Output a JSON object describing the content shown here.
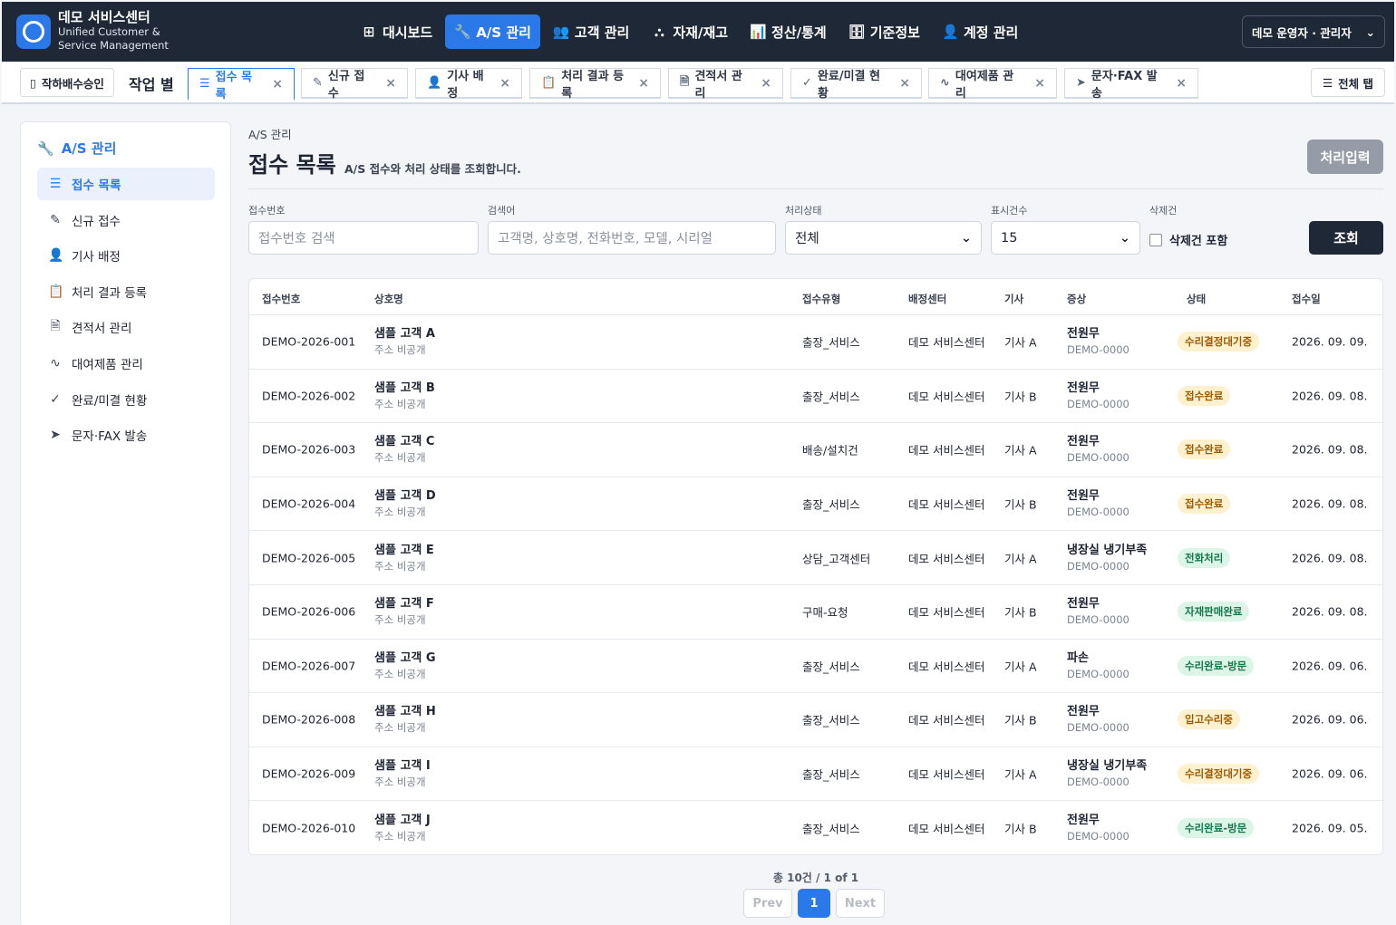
{
  "brand": {
    "title": "데모 서비스센터",
    "subtitle": "Unified Customer & Service Management"
  },
  "nav": [
    {
      "label": "대시보드",
      "icon": "grid-icon",
      "glyph": "⊞"
    },
    {
      "label": "A/S 관리",
      "icon": "wrench-icon",
      "glyph": "🔧"
    },
    {
      "label": "고객 관리",
      "icon": "users-icon",
      "glyph": "👥"
    },
    {
      "label": "자재/재고",
      "icon": "boxes-icon",
      "glyph": "⛬"
    },
    {
      "label": "정산/통계",
      "icon": "bar-chart-icon",
      "glyph": "📊"
    },
    {
      "label": "기준정보",
      "icon": "database-icon",
      "glyph": "🗄"
    },
    {
      "label": "계정 관리",
      "icon": "user-settings-icon",
      "glyph": "👤"
    }
  ],
  "user": {
    "label": "데모 운영자 · 관리자"
  },
  "tabbar": {
    "approve_button": "작하배수승인",
    "work_label": "작업 별",
    "all_tabs": "전체 탭",
    "tabs": [
      {
        "label": "접수 목록",
        "glyph": "☰"
      },
      {
        "label": "신규 접수",
        "glyph": "✎"
      },
      {
        "label": "기사 배정",
        "glyph": "👤"
      },
      {
        "label": "처리 결과 등록",
        "glyph": "📋"
      },
      {
        "label": "견적서 관리",
        "glyph": "🗎"
      },
      {
        "label": "완료/미결 현황",
        "glyph": "✓"
      },
      {
        "label": "대여제품 관리",
        "glyph": "∿"
      },
      {
        "label": "문자·FAX 발송",
        "glyph": "➤"
      }
    ]
  },
  "sidebar": {
    "heading": "A/S 관리",
    "items": [
      {
        "label": "접수 목록",
        "glyph": "☰"
      },
      {
        "label": "신규 접수",
        "glyph": "✎"
      },
      {
        "label": "기사 배정",
        "glyph": "👤"
      },
      {
        "label": "처리 결과 등록",
        "glyph": "📋"
      },
      {
        "label": "견적서 관리",
        "glyph": "🗎"
      },
      {
        "label": "대여제품 관리",
        "glyph": "∿"
      },
      {
        "label": "완료/미결 현황",
        "glyph": "✓"
      },
      {
        "label": "문자·FAX 발송",
        "glyph": "➤"
      }
    ]
  },
  "page": {
    "breadcrumb": "A/S 관리",
    "title": "접수 목록",
    "description": "A/S 접수와 처리 상태를 조회합니다.",
    "process_button": "처리입력"
  },
  "filters": {
    "receipt_label": "접수번호",
    "receipt_placeholder": "접수번호 검색",
    "search_label": "검색어",
    "search_placeholder": "고객명, 상호명, 전화번호, 모델, 시리얼",
    "status_label": "처리상태",
    "status_value": "전체",
    "count_label": "표시건수",
    "count_value": "15",
    "deleted_label": "삭제건",
    "deleted_checkbox": "삭제건 포함",
    "search_button": "조회"
  },
  "table": {
    "headers": [
      "접수번호",
      "상호명",
      "접수유형",
      "배정센터",
      "기사",
      "증상",
      "상태",
      "접수일"
    ],
    "rows": [
      {
        "id": "DEMO-2026-001",
        "name": "샘플 고객 A",
        "addr": "주소 비공개",
        "type": "출장_서비스",
        "center": "데모 서비스센터",
        "tech": "기사 A",
        "symptom": "전원무",
        "code": "DEMO-0000",
        "status": "수리결정대기중",
        "status_kind": "amber",
        "date": "2026. 09. 09."
      },
      {
        "id": "DEMO-2026-002",
        "name": "샘플 고객 B",
        "addr": "주소 비공개",
        "type": "출장_서비스",
        "center": "데모 서비스센터",
        "tech": "기사 B",
        "symptom": "전원무",
        "code": "DEMO-0000",
        "status": "접수완료",
        "status_kind": "amber",
        "date": "2026. 09. 08."
      },
      {
        "id": "DEMO-2026-003",
        "name": "샘플 고객 C",
        "addr": "주소 비공개",
        "type": "배송/설치건",
        "center": "데모 서비스센터",
        "tech": "기사 A",
        "symptom": "전원무",
        "code": "DEMO-0000",
        "status": "접수완료",
        "status_kind": "amber",
        "date": "2026. 09. 08."
      },
      {
        "id": "DEMO-2026-004",
        "name": "샘플 고객 D",
        "addr": "주소 비공개",
        "type": "출장_서비스",
        "center": "데모 서비스센터",
        "tech": "기사 B",
        "symptom": "전원무",
        "code": "DEMO-0000",
        "status": "접수완료",
        "status_kind": "amber",
        "date": "2026. 09. 08."
      },
      {
        "id": "DEMO-2026-005",
        "name": "샘플 고객 E",
        "addr": "주소 비공개",
        "type": "상담_고객센터",
        "center": "데모 서비스센터",
        "tech": "기사 A",
        "symptom": "냉장실 냉기부족",
        "code": "DEMO-0000",
        "status": "전화처리",
        "status_kind": "green",
        "date": "2026. 09. 08."
      },
      {
        "id": "DEMO-2026-006",
        "name": "샘플 고객 F",
        "addr": "주소 비공개",
        "type": "구매-요청",
        "center": "데모 서비스센터",
        "tech": "기사 B",
        "symptom": "전원무",
        "code": "DEMO-0000",
        "status": "자재판매완료",
        "status_kind": "green",
        "date": "2026. 09. 08."
      },
      {
        "id": "DEMO-2026-007",
        "name": "샘플 고객 G",
        "addr": "주소 비공개",
        "type": "출장_서비스",
        "center": "데모 서비스센터",
        "tech": "기사 A",
        "symptom": "파손",
        "code": "DEMO-0000",
        "status": "수리완료-방문",
        "status_kind": "green",
        "date": "2026. 09. 06."
      },
      {
        "id": "DEMO-2026-008",
        "name": "샘플 고객 H",
        "addr": "주소 비공개",
        "type": "출장_서비스",
        "center": "데모 서비스센터",
        "tech": "기사 B",
        "symptom": "전원무",
        "code": "DEMO-0000",
        "status": "입고수리중",
        "status_kind": "amber",
        "date": "2026. 09. 06."
      },
      {
        "id": "DEMO-2026-009",
        "name": "샘플 고객 I",
        "addr": "주소 비공개",
        "type": "출장_서비스",
        "center": "데모 서비스센터",
        "tech": "기사 A",
        "symptom": "냉장실 냉기부족",
        "code": "DEMO-0000",
        "status": "수리결정대기중",
        "status_kind": "amber",
        "date": "2026. 09. 06."
      },
      {
        "id": "DEMO-2026-010",
        "name": "샘플 고객 J",
        "addr": "주소 비공개",
        "type": "출장_서비스",
        "center": "데모 서비스센터",
        "tech": "기사 B",
        "symptom": "전원무",
        "code": "DEMO-0000",
        "status": "수리완료-방문",
        "status_kind": "green",
        "date": "2026. 09. 05."
      }
    ]
  },
  "pagination": {
    "info": "총 10건 / 1 of 1",
    "prev": "Prev",
    "current": "1",
    "next": "Next"
  },
  "colors": {
    "accent": "#2b79e8",
    "navbar": "#1f2836",
    "badge_amber_bg": "#fdf1cf",
    "badge_amber_fg": "#a05a00",
    "badge_green_bg": "#ddf5e6",
    "badge_green_fg": "#13794a"
  }
}
